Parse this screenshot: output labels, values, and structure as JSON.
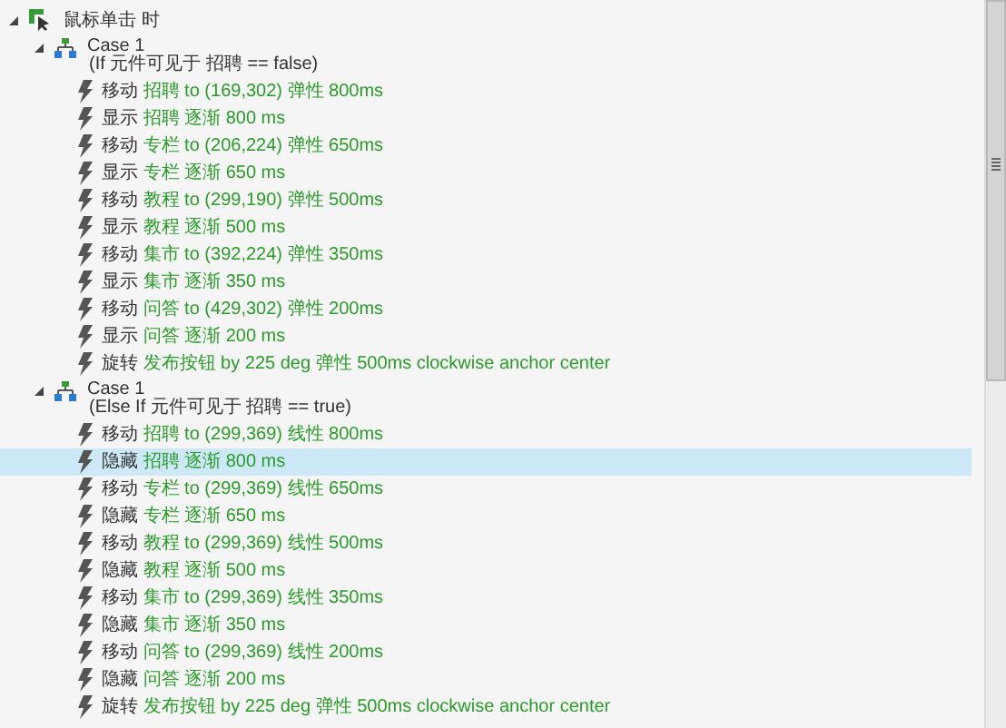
{
  "tree": [
    {
      "label": "鼠标单击 时",
      "expanded": true,
      "children": [
        {
          "label": "Case 1",
          "condition": "(If 元件可见于 招聘 == false)",
          "expanded": true,
          "children": [
            {
              "verb": "移动",
              "detail": "招聘 to (169,302) 弹性 800ms",
              "selected": false
            },
            {
              "verb": "显示",
              "detail": "招聘 逐渐 800 ms",
              "selected": false
            },
            {
              "verb": "移动",
              "detail": "专栏 to (206,224) 弹性 650ms",
              "selected": false
            },
            {
              "verb": "显示",
              "detail": "专栏 逐渐 650 ms",
              "selected": false
            },
            {
              "verb": "移动",
              "detail": "教程 to (299,190) 弹性 500ms",
              "selected": false
            },
            {
              "verb": "显示",
              "detail": "教程 逐渐 500 ms",
              "selected": false
            },
            {
              "verb": "移动",
              "detail": "集市 to (392,224) 弹性 350ms",
              "selected": false
            },
            {
              "verb": "显示",
              "detail": "集市 逐渐 350 ms",
              "selected": false
            },
            {
              "verb": "移动",
              "detail": "问答 to (429,302) 弹性 200ms",
              "selected": false
            },
            {
              "verb": "显示",
              "detail": "问答 逐渐 200 ms",
              "selected": false
            },
            {
              "verb": "旋转",
              "detail": "发布按钮 by 225 deg 弹性 500ms clockwise anchor center",
              "selected": false
            }
          ]
        },
        {
          "label": "Case 1",
          "condition": "(Else If 元件可见于 招聘 == true)",
          "expanded": true,
          "children": [
            {
              "verb": "移动",
              "detail": "招聘 to (299,369) 线性 800ms",
              "selected": false
            },
            {
              "verb": "隐藏",
              "detail": "招聘 逐渐 800 ms",
              "selected": true
            },
            {
              "verb": "移动",
              "detail": "专栏 to (299,369) 线性 650ms",
              "selected": false
            },
            {
              "verb": "隐藏",
              "detail": "专栏 逐渐 650 ms",
              "selected": false
            },
            {
              "verb": "移动",
              "detail": "教程 to (299,369) 线性 500ms",
              "selected": false
            },
            {
              "verb": "隐藏",
              "detail": "教程 逐渐 500 ms",
              "selected": false
            },
            {
              "verb": "移动",
              "detail": "集市 to (299,369) 线性 350ms",
              "selected": false
            },
            {
              "verb": "隐藏",
              "detail": "集市 逐渐 350 ms",
              "selected": false
            },
            {
              "verb": "移动",
              "detail": "问答 to (299,369) 线性 200ms",
              "selected": false
            },
            {
              "verb": "隐藏",
              "detail": "问答 逐渐 200 ms",
              "selected": false
            },
            {
              "verb": "旋转",
              "detail": "发布按钮 by 225 deg 弹性 500ms clockwise anchor center",
              "selected": false
            }
          ]
        }
      ]
    }
  ]
}
